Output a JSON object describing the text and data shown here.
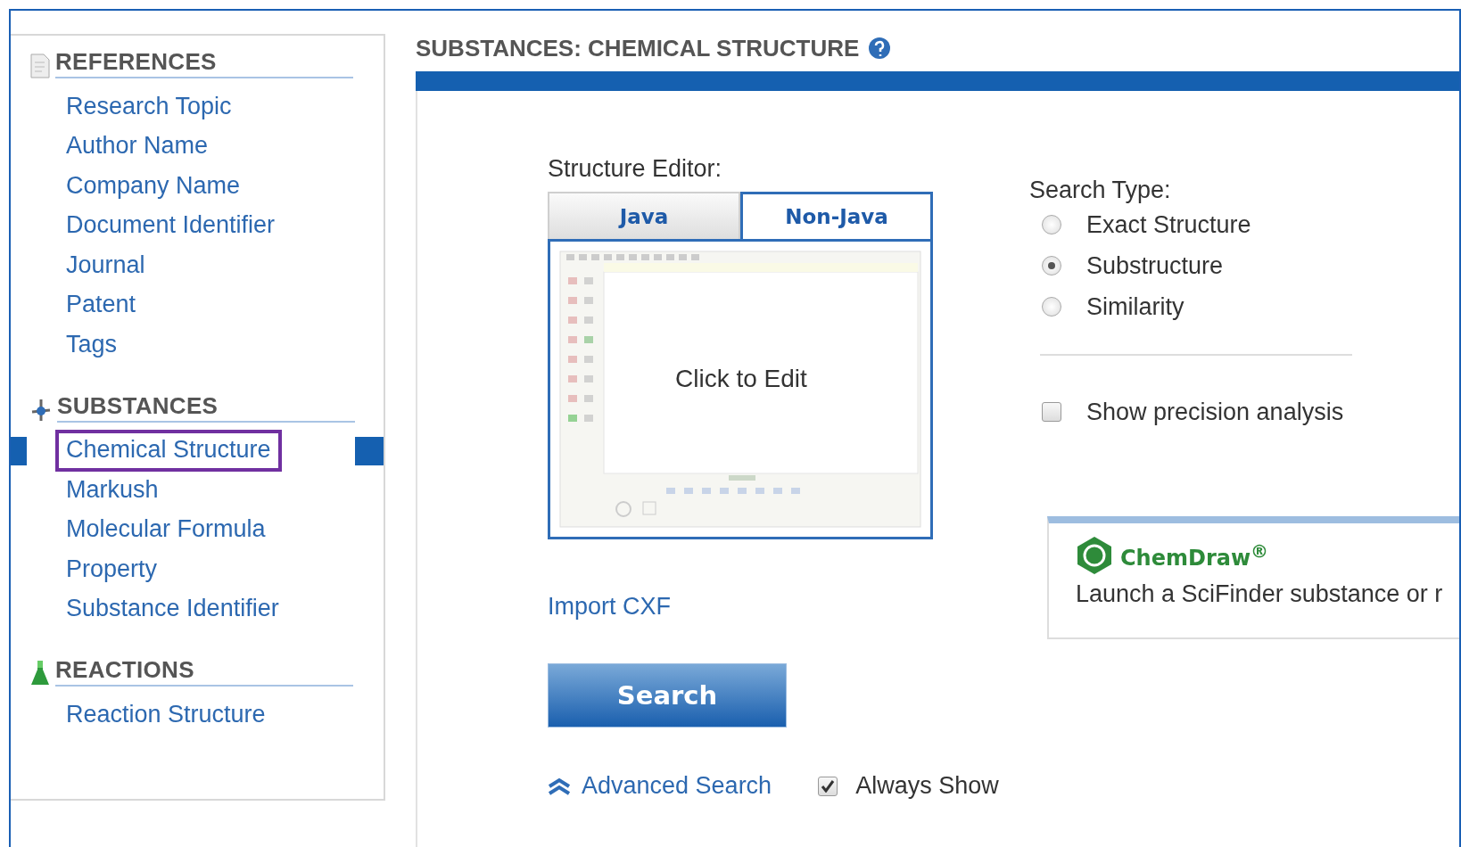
{
  "sidebar": {
    "sections": [
      {
        "kind": "references",
        "title": "REFERENCES",
        "items": [
          {
            "label": "Research Topic",
            "selected": false
          },
          {
            "label": "Author Name",
            "selected": false
          },
          {
            "label": "Company Name",
            "selected": false
          },
          {
            "label": "Document Identifier",
            "selected": false
          },
          {
            "label": "Journal",
            "selected": false
          },
          {
            "label": "Patent",
            "selected": false
          },
          {
            "label": "Tags",
            "selected": false
          }
        ]
      },
      {
        "kind": "substances",
        "title": "SUBSTANCES",
        "items": [
          {
            "label": "Chemical Structure",
            "selected": true
          },
          {
            "label": "Markush",
            "selected": false
          },
          {
            "label": "Molecular Formula",
            "selected": false
          },
          {
            "label": "Property",
            "selected": false
          },
          {
            "label": "Substance Identifier",
            "selected": false
          }
        ]
      },
      {
        "kind": "reactions",
        "title": "REACTIONS",
        "items": [
          {
            "label": "Reaction Structure",
            "selected": false
          }
        ]
      }
    ]
  },
  "main": {
    "title": "SUBSTANCES: CHEMICAL STRUCTURE",
    "editor": {
      "label": "Structure Editor:",
      "tabs": [
        {
          "label": "Java",
          "selected": false
        },
        {
          "label": "Non-Java",
          "selected": true
        }
      ],
      "prompt": "Click to Edit"
    },
    "import_link": "Import CXF",
    "search_button": "Search",
    "advanced_search": "Advanced Search",
    "always_show": {
      "label": "Always Show",
      "checked": true
    },
    "search_type": {
      "label": "Search Type:",
      "options": [
        {
          "label": "Exact Structure",
          "selected": false
        },
        {
          "label": "Substructure",
          "selected": true
        },
        {
          "label": "Similarity",
          "selected": false
        }
      ]
    },
    "precision": {
      "label": "Show precision analysis",
      "checked": false
    },
    "chemdraw": {
      "brand": "ChemDraw$^{®}$",
      "text": "Launch a SciFinder substance or r"
    }
  }
}
